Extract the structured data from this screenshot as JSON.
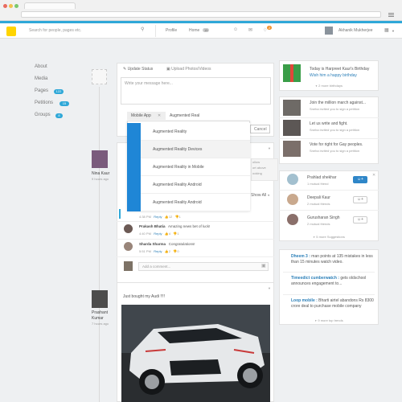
{
  "nav": {
    "search_placeholder": "Search for people, pages etc.",
    "profile": "Profile",
    "home": "Home",
    "home_count": "15",
    "notif_count": "2",
    "user_name": "Akhanik Mukherjee"
  },
  "sidebar": {
    "items": [
      {
        "label": "About"
      },
      {
        "label": "Media"
      },
      {
        "label": "Pages",
        "badge": "122"
      },
      {
        "label": "Petitions",
        "badge": "15"
      },
      {
        "label": "Groups",
        "badge": "8"
      }
    ]
  },
  "composer": {
    "tab_status": "Update Status",
    "tab_photos": "Upload Photos/Videos",
    "placeholder": "Write your message here..."
  },
  "autocomplete": {
    "chip": "Mobile App",
    "query": "Augmented Real",
    "cancel": "Cancel",
    "options": [
      "Augmented Reality",
      "Augmented Reality Devices",
      "Augmented Reality in Mobile",
      "Augmented Reality Android",
      "Augmented Reality Android"
    ]
  },
  "post1": {
    "author": "Nina Kaur",
    "time": "9 hours ago",
    "show_all": "Show All",
    "behind_text": [
      "ollow",
      "ort above",
      "ooking"
    ]
  },
  "comments": [
    {
      "time": "4:38 PM",
      "reply": "Reply",
      "likes": "12",
      "dislikes": "1"
    },
    {
      "name": "Prakash Bhatia",
      "text": "Amazing news bet of luck!",
      "time": "4:40 PM",
      "reply": "Reply",
      "likes": "4",
      "dislikes": "1"
    },
    {
      "name": "Sharda Sharma",
      "text": "Congratulations!",
      "time": "5:51 PM",
      "reply": "Reply",
      "likes": "2",
      "dislikes": "0"
    }
  ],
  "comment_placeholder": "Add a comment...",
  "post2": {
    "author": "Prashant Kumar",
    "time": "7 hours ago",
    "text": "Just bought my Audi !!!!"
  },
  "birthday": {
    "line1": "Today is Harpreet Kaur's Birthday",
    "link": "Wish him a happy birthday",
    "more": "2 more birthdays"
  },
  "petitions": {
    "items": [
      {
        "title": "Join the million march against...",
        "sub": "Sneha invited you to sign a petition"
      },
      {
        "title": "Let us write and fight.",
        "sub": "Sneha invited you to sign a petition"
      },
      {
        "title": "Vote for right for Gay peoples.",
        "sub": "Sneha invited you to sign a petition"
      }
    ]
  },
  "suggestions": {
    "items": [
      {
        "name": "Prahlad shekhar",
        "mutual": "1 mutual friend"
      },
      {
        "name": "Deepali Kaur",
        "mutual": "2 mutual friends"
      },
      {
        "name": "Gurusharan Singh",
        "mutual": "2 mutual friends"
      }
    ],
    "more": "5 more Suggestions"
  },
  "trends": {
    "items": [
      {
        "tag": "Dheem 3 :",
        "text": "man points at 135 mistakes in less than 15 minutes watch video."
      },
      {
        "tag": "Timeedict cumberwatch :",
        "text": "gets oldschool announces engagement to..."
      },
      {
        "tag": "Loop mobile :",
        "text": "Bharti airtel abandons Rs 8300 crore deal to purchase mobile company"
      }
    ],
    "more": "9 more top trends"
  }
}
